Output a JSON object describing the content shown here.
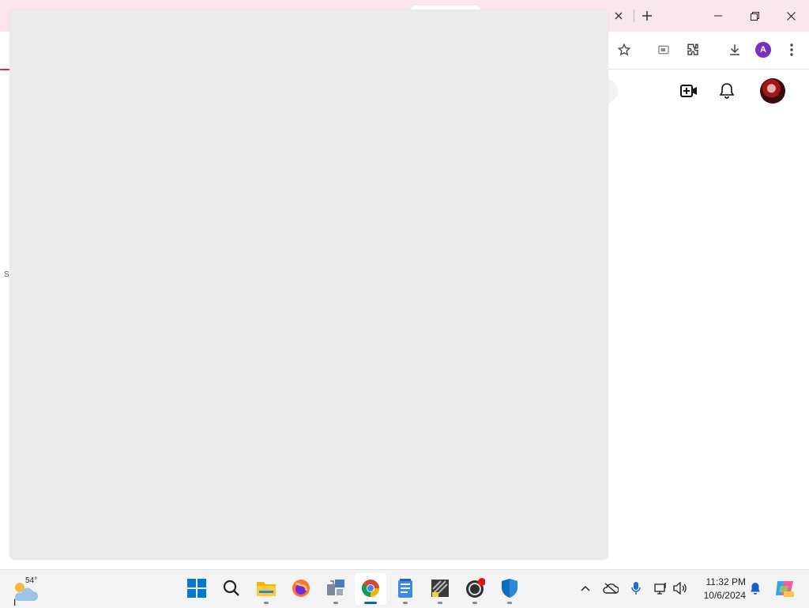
{
  "browser": {
    "profile_initial": "A"
  },
  "page": {
    "stray_text": "S"
  },
  "taskbar": {
    "weather_temp": "54°",
    "cursor_glyph": "I",
    "clock_time": "11:32 PM",
    "clock_date": "10/6/2024",
    "apps": [
      "start",
      "search",
      "file-explorer",
      "firefox",
      "network-app",
      "chrome",
      "notepad",
      "inkscape",
      "obs-studio",
      "windows-security"
    ]
  },
  "colors": {
    "titlebar": "#fbe6ee",
    "overlay": "#ebebeb",
    "accent": "#0067c0",
    "youtube_red": "#d9323b"
  }
}
